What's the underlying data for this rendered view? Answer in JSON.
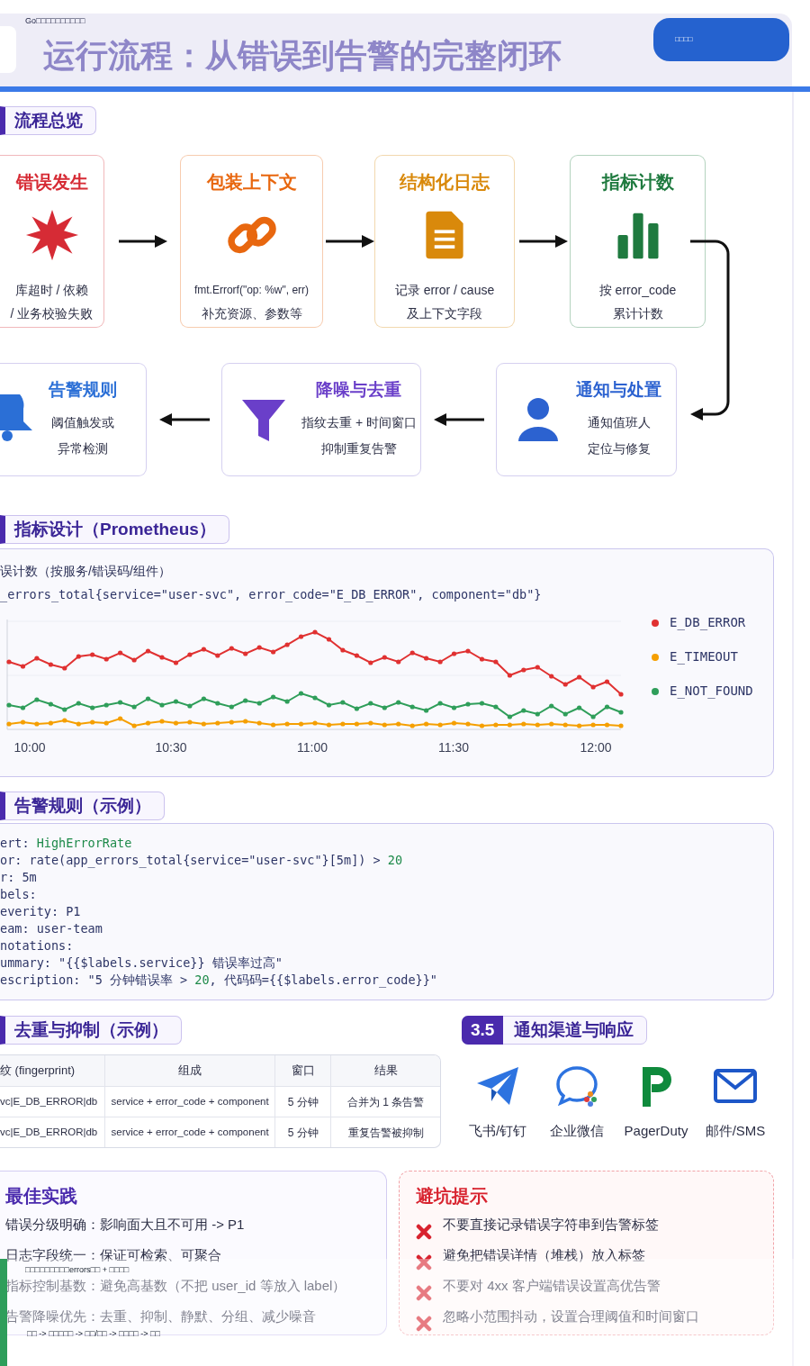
{
  "header": {
    "caption": "Go□□□□□□□□□□",
    "title": "运行流程：从错误到告警的完整闭环",
    "button": "□□□□"
  },
  "flow": {
    "heading": "流程总览",
    "top_row": [
      {
        "title": "错误发生",
        "kind": "burst",
        "color": "#d62b35",
        "lines": [
          "库超时 / 依赖",
          "/ 业务校验失败"
        ]
      },
      {
        "title": "包装上下文",
        "kind": "link",
        "color": "#e8670f",
        "lines": [
          "fmt.Errorf(\"op: %w\", err)",
          "补充资源、参数等"
        ]
      },
      {
        "title": "结构化日志",
        "kind": "document",
        "color": "#d9890b",
        "lines": [
          "记录 error / cause",
          "及上下文字段"
        ]
      },
      {
        "title": "指标计数",
        "kind": "bars",
        "color": "#1f7a3f",
        "lines": [
          "按 error_code",
          "累计计数"
        ]
      }
    ],
    "bottom_row": [
      {
        "title": "告警规则",
        "kind": "bell",
        "color": "#2b6fd6",
        "lines": [
          "阈值触发或",
          "异常检测"
        ]
      },
      {
        "title": "降噪与去重",
        "kind": "funnel",
        "color": "#6a3fc9",
        "lines": [
          "指纹去重 + 时间窗口",
          "抑制重复告警"
        ]
      },
      {
        "title": "通知与处置",
        "kind": "person",
        "color": "#2c62d0",
        "lines": [
          "通知值班人",
          "定位与修复"
        ]
      }
    ]
  },
  "metrics": {
    "heading": "指标设计（Prometheus）",
    "caption": "误计数（按服务/错误码/组件）",
    "query": "_errors_total{service=\"user-svc\", error_code=\"E_DB_ERROR\", component=\"db\"}",
    "x_labels": [
      "10:00",
      "10:30",
      "11:00",
      "11:30",
      "12:00"
    ],
    "legend": [
      {
        "label": "E_DB_ERROR",
        "color": "#e03131"
      },
      {
        "label": "E_TIMEOUT",
        "color": "#f59f00"
      },
      {
        "label": "E_NOT_FOUND",
        "color": "#2f9e5a"
      }
    ]
  },
  "alert_rule": {
    "heading": "告警规则（示例）",
    "lines": [
      [
        {
          "text": "ert: ",
          "kind": "plain"
        },
        {
          "text": "HighErrorRate",
          "kind": "accent"
        }
      ],
      [
        {
          "text": "or: rate(app_errors_total{service=\"user-svc\"}[5m]) > ",
          "kind": "plain"
        },
        {
          "text": "20",
          "kind": "accent"
        }
      ],
      [
        {
          "text": "r: 5m",
          "kind": "plain"
        }
      ],
      [
        {
          "text": "bels:",
          "kind": "plain"
        }
      ],
      [
        {
          "text": "everity: P1",
          "kind": "plain"
        }
      ],
      [
        {
          "text": "eam: user-team",
          "kind": "plain"
        }
      ],
      [
        {
          "text": "notations:",
          "kind": "plain"
        }
      ],
      [
        {
          "text": "ummary: \"{{$labels.service}} 错误率过高\"",
          "kind": "plain"
        }
      ],
      [
        {
          "text": "escription: \"5 分钟错误率 > ",
          "kind": "plain"
        },
        {
          "text": "20",
          "kind": "accent"
        },
        {
          "text": ", 代码码={{$labels.error_code}}\"",
          "kind": "plain"
        }
      ]
    ]
  },
  "dedup": {
    "heading": "去重与抑制（示例）",
    "columns": [
      "纹 (fingerprint)",
      "组成",
      "窗口",
      "结果"
    ],
    "rows": [
      [
        "vc|E_DB_ERROR|db",
        "service + error_code + component",
        "5 分钟",
        "合并为 1 条告警"
      ],
      [
        "vc|E_DB_ERROR|db",
        "service + error_code + component",
        "5 分钟",
        "重复告警被抑制"
      ]
    ]
  },
  "channels": {
    "number": "3.5",
    "heading": "通知渠道与响应",
    "items": [
      {
        "label": "飞书/钉钉",
        "kind": "plane"
      },
      {
        "label": "企业微信",
        "kind": "chat"
      },
      {
        "label": "PagerDuty",
        "kind": "pager"
      },
      {
        "label": "邮件/SMS",
        "kind": "mail"
      }
    ]
  },
  "best_practices": {
    "title": "最佳实践",
    "items": [
      "错误分级明确：影响面大且不可用 -> P1",
      "日志字段统一：保证可检索、可聚合",
      "指标控制基数：避免高基数（不把 user_id 等放入 label）",
      "告警降噪优先：去重、抑制、静默、分组、减少噪音"
    ]
  },
  "pitfalls": {
    "title": "避坑提示",
    "items": [
      "不要直接记录错误字符串到告警标签",
      "避免把错误详情（堆栈）放入标签",
      "不要对 4xx 客户端错误设置高优告警",
      "忽略小范围抖动，设置合理阈值和时间窗口"
    ]
  },
  "overlay": {
    "lines": [
      "□□□□□□□□□errors□□ + □□□□",
      "□□ -> □□□□□ -> □□/□□ -> □□□□ -> □□"
    ]
  }
}
